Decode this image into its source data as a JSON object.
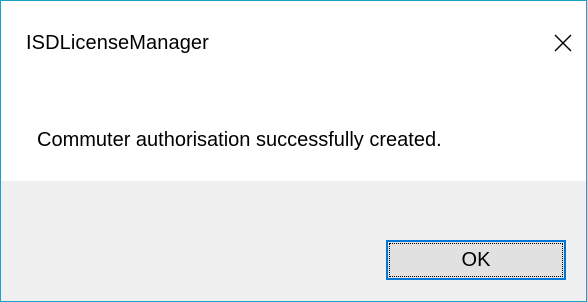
{
  "window": {
    "title": "ISDLicenseManager",
    "close_icon": "close-icon",
    "accent_color": "#1ba1c4"
  },
  "dialog": {
    "message": "Commuter authorisation successfully created.",
    "ok_label": "OK",
    "focus_color": "#0078d7",
    "footer_color": "#f0f0f0"
  }
}
